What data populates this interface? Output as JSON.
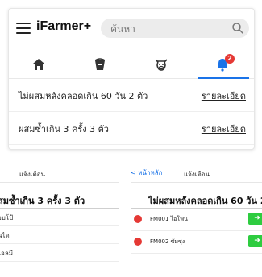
{
  "header": {
    "brand": "iFarmer+",
    "search_placeholder": "ค้นหา"
  },
  "tabs": [
    {
      "icon": "home-icon"
    },
    {
      "icon": "bucket-icon"
    },
    {
      "icon": "cow-icon"
    },
    {
      "icon": "bell-icon",
      "badge": "2",
      "active": true
    }
  ],
  "notifications": [
    {
      "text": "ไม่ผสมหลังคลอดเกิน 60 วัน 2 ตัว",
      "link": "รายละเอียด"
    },
    {
      "text": "ผสมซ้ำเกิน 3 ครั้ง 3 ตัว",
      "link": "รายละเอียด"
    }
  ],
  "left_panel": {
    "title": "แจ้งเตือน",
    "heading": "สมซ้ำเกิน 3 ครั้ง 3 ตัว",
    "items": [
      "อบโป้",
      "นได",
      "ไอลมี"
    ]
  },
  "right_panel": {
    "back": "< หน้าหลัก",
    "title": "แจ้งเตือน",
    "heading": "ไม่ผสมหลังคลอดเกิน 60 วัน 2",
    "items": [
      {
        "code": "FM001 ไอโฟน",
        "action": "➜"
      },
      {
        "code": "FM002 ซัมซุง",
        "action": "➜"
      }
    ]
  },
  "colors": {
    "accent": "#1a73e8",
    "badge": "#e53935",
    "go": "#2ecc40"
  }
}
